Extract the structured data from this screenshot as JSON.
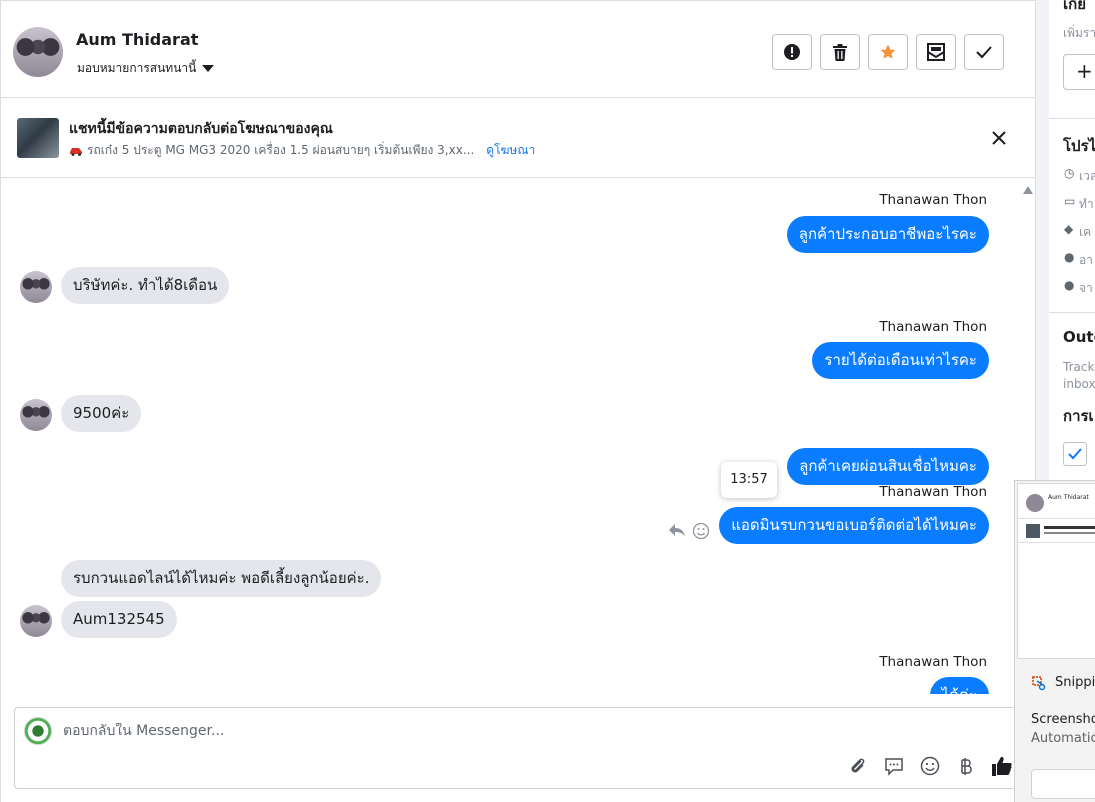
{
  "header": {
    "contact_name": "Aum Thidarat",
    "assign_label": "มอบหมายการสนทนานี้"
  },
  "ad": {
    "title": "แชทนี้มีข้อความตอบกลับต่อโฆษณาของคุณ",
    "subtitle": "รถเก๋ง 5 ประตู MG MG3 2020 เครื่อง 1.5 ผ่อนสบายๆ เริ่มต้นเพียง 3,xx...",
    "link": "ดูโฆษณา"
  },
  "messages": [
    {
      "sender": "Thanawan Thon",
      "text": "ลูกค้าประกอบอาชีพอะไรคะ",
      "dir": "out"
    },
    {
      "text": "บริษัทค่ะ. ทำได้8เดือน",
      "dir": "in"
    },
    {
      "sender": "Thanawan Thon",
      "text": "รายได้ต่อเดือนเท่าไรคะ",
      "dir": "out"
    },
    {
      "text": "9500ค่ะ",
      "dir": "in"
    },
    {
      "text": "ลูกค้าเคยผ่อนสินเชื่อไหมคะ",
      "dir": "out"
    },
    {
      "sender": "Thanawan Thon",
      "text": "แอดมินรบกวนขอเบอร์ติดต่อได้ไหมคะ",
      "dir": "out"
    },
    {
      "text": "รบกวนแอดไลน์ได้ไหมค่ะ พอดีเลี้ยงลูกน้อยค่ะ.",
      "dir": "in"
    },
    {
      "text": "Aum132545",
      "dir": "in"
    },
    {
      "sender": "Thanawan Thon",
      "text": "ได้ค่ะ",
      "dir": "out"
    }
  ],
  "tooltip_time": "13:57",
  "composer": {
    "placeholder": "ตอบกลับใน Messenger..."
  },
  "right_panel": {
    "top_text": "เกี่ย",
    "add_text": "เพิ่มรา",
    "plus": "+",
    "profile_title": "โปรไ",
    "profile_rows": [
      "เวล",
      "ทำ",
      "เค",
      "อา",
      "จา"
    ],
    "outcome_title": "Outc",
    "track_l1": "Track l",
    "track_l2": "inbox",
    "action_title": "การเ"
  },
  "snip": {
    "title": "Snippin",
    "line1": "Screensho",
    "line2": "Automatica",
    "preview_name": "Aum Thidarat"
  },
  "colors": {
    "accent": "#0a7cff",
    "star": "#f7923a"
  }
}
